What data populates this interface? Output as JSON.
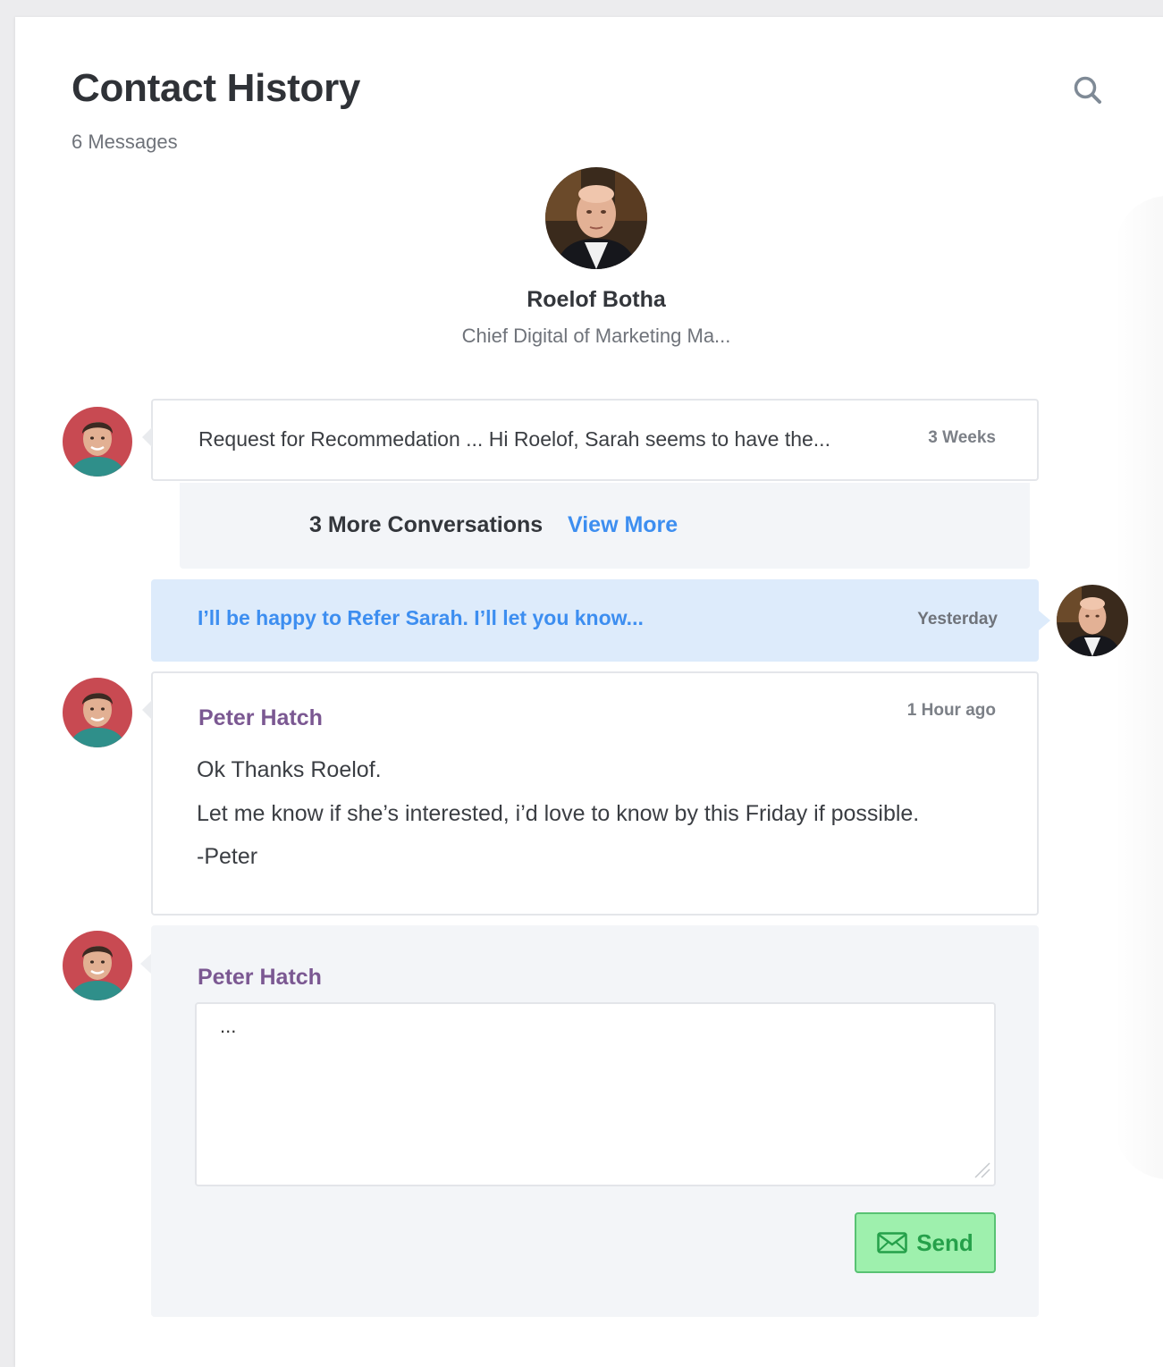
{
  "header": {
    "title": "Contact History",
    "subtitle": "6 Messages",
    "search_icon": "search-icon"
  },
  "contact": {
    "name": "Roelof Botha",
    "role": "Chief Digital of Marketing Ma..."
  },
  "messages": [
    {
      "preview": "Request for Recommedation ... Hi Roelof, Sarah seems to have the...",
      "time": "3 Weeks"
    }
  ],
  "more": {
    "count_label": "3 More Conversations",
    "link_label": "View More"
  },
  "reply": {
    "text": "I’ll be happy to Refer Sarah. I’ll let you know...",
    "time": "Yesterday"
  },
  "expanded_message": {
    "sender": "Peter Hatch",
    "time": "1 Hour ago",
    "lines": [
      "Ok Thanks Roelof.",
      "Let me know if she’s interested, i’d love to know by this Friday if possible.",
      "-Peter"
    ]
  },
  "compose": {
    "sender": "Peter Hatch",
    "value": "...",
    "send_label": "Send",
    "send_icon": "envelope-icon"
  },
  "colors": {
    "accent_blue": "#3d8ef0",
    "sender_purple": "#7b5892",
    "send_green": "#25a04a",
    "reply_bg": "#ddebfb"
  }
}
